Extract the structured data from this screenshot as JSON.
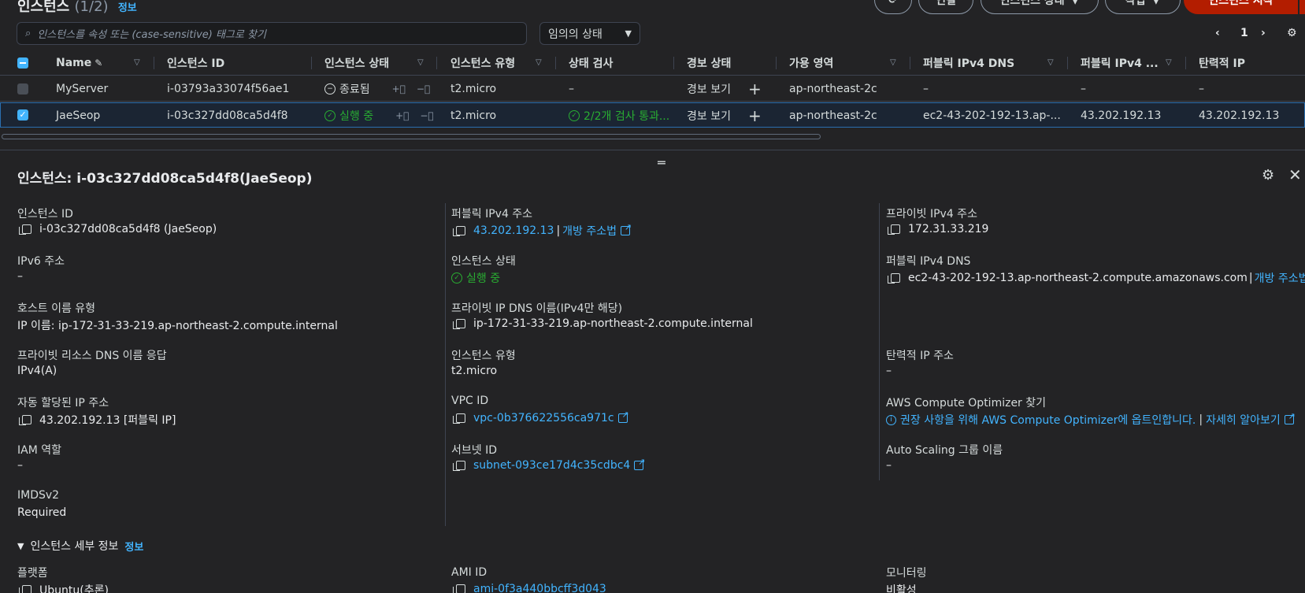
{
  "header": {
    "title": "인스턴스",
    "count": "(1/2)",
    "info": "정보",
    "buttons": {
      "connect": "연결",
      "state": "인스턴스 상태",
      "actions": "작업",
      "launch": "인스턴스 시작"
    }
  },
  "search": {
    "placeholder": "인스턴스를 속성 또는 (case-sensitive) 태그로 찾기"
  },
  "filter": {
    "selected": "임의의 상태"
  },
  "pager": {
    "page": "1"
  },
  "table": {
    "columns": [
      "Name",
      "인스턴스 ID",
      "인스턴스 상태",
      "인스턴스 유형",
      "상태 검사",
      "경보 상태",
      "가용 영역",
      "퍼블릭 IPv4 DNS",
      "퍼블릭 IPv4 ...",
      "탄력적 IP"
    ],
    "rows": [
      {
        "name": "MyServer",
        "id": "i-03793a33074f56ae1",
        "state": "종료됨",
        "type": "t2.micro",
        "check": "–",
        "alarm": "경보 보기",
        "az": "ap-northeast-2c",
        "dns": "–",
        "ipv4": "–",
        "eip": "–"
      },
      {
        "name": "JaeSeop",
        "id": "i-03c327dd08ca5d4f8",
        "state": "실행 중",
        "type": "t2.micro",
        "check": "2/2개 검사 통과...",
        "alarm": "경보 보기",
        "az": "ap-northeast-2c",
        "dns": "ec2-43-202-192-13.ap-...",
        "ipv4": "43.202.192.13",
        "eip": "43.202.192.13"
      }
    ]
  },
  "detail": {
    "title": "인스턴스: i-03c327dd08ca5d4f8(JaeSeop)",
    "c1": [
      {
        "label": "인스턴스 ID",
        "value": "i-03c327dd08ca5d4f8 (JaeSeop)"
      },
      {
        "label": "IPv6 주소",
        "value": "–"
      },
      {
        "label": "호스트 이름 유형",
        "value": "IP 이름: ip-172-31-33-219.ap-northeast-2.compute.internal"
      },
      {
        "label": "프라이빗 리소스 DNS 이름 응답",
        "value": "IPv4(A)"
      },
      {
        "label": "자동 할당된 IP 주소",
        "value": "43.202.192.13 [퍼블릭 IP]"
      },
      {
        "label": "IAM 역할",
        "value": "–"
      },
      {
        "label": "IMDSv2",
        "value": "Required"
      }
    ],
    "c2": [
      {
        "label": "퍼블릭 IPv4 주소",
        "value": "43.202.192.13",
        "extra": "개방 주소법"
      },
      {
        "label": "인스턴스 상태",
        "value": "실행 중"
      },
      {
        "label": "프라이빗 IP DNS 이름(IPv4만 해당)",
        "value": "ip-172-31-33-219.ap-northeast-2.compute.internal"
      },
      {
        "label": "인스턴스 유형",
        "value": "t2.micro"
      },
      {
        "label": "VPC ID",
        "value": "vpc-0b376622556ca971c"
      },
      {
        "label": "서브넷 ID",
        "value": "subnet-093ce17d4c35cdbc4"
      }
    ],
    "c3": [
      {
        "label": "프라이빗 IPv4 주소",
        "value": "172.31.33.219"
      },
      {
        "label": "퍼블릭 IPv4 DNS",
        "value": "ec2-43-202-192-13.ap-northeast-2.compute.amazonaws.com",
        "extra": "개방 주소법"
      },
      {
        "label": "탄력적 IP 주소",
        "value": "–"
      },
      {
        "label": "AWS Compute Optimizer 찾기",
        "value": "권장 사항을 위해 AWS Compute Optimizer에 옵트인합니다.",
        "extra": "자세히 알아보기"
      },
      {
        "label": "Auto Scaling 그룹 이름",
        "value": "–"
      }
    ],
    "section": {
      "title": "인스턴스 세부 정보",
      "info": "정보"
    },
    "bottom": {
      "platform_label": "플랫폼",
      "platform": "Ubuntu(추론)",
      "ami_label": "AMI ID",
      "ami": "ami-0f3a440bbcff3d043",
      "mon_label": "모니터링",
      "mon": "비활성"
    }
  },
  "colors": {
    "accent": "#42b4ff",
    "success": "#29ad32",
    "primary": "#b31d00"
  }
}
